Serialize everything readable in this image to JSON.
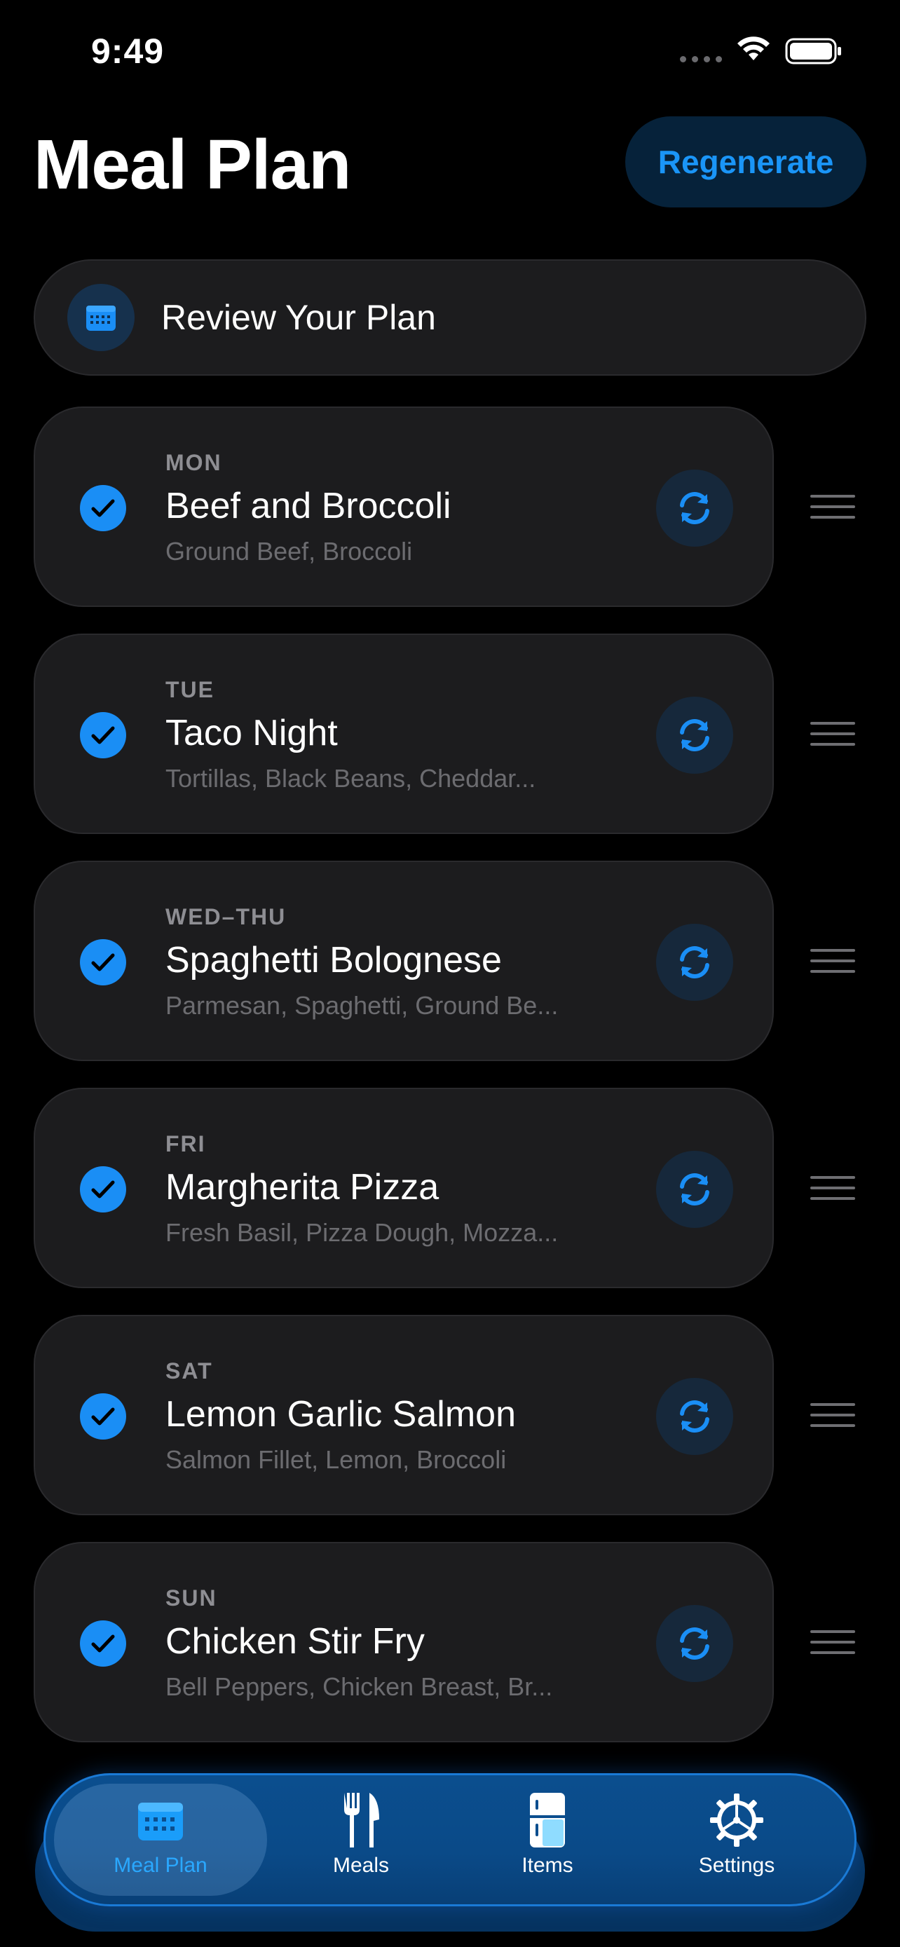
{
  "status_bar": {
    "time": "9:49"
  },
  "header": {
    "title": "Meal Plan",
    "regenerate_label": "Regenerate"
  },
  "review": {
    "label": "Review Your Plan"
  },
  "meals": [
    {
      "day": "MON",
      "name": "Beef and Broccoli",
      "ingredients": "Ground Beef, Broccoli",
      "checked": true
    },
    {
      "day": "TUE",
      "name": "Taco Night",
      "ingredients": "Tortillas, Black Beans, Cheddar...",
      "checked": true
    },
    {
      "day": "WED–THU",
      "name": "Spaghetti Bolognese",
      "ingredients": "Parmesan, Spaghetti, Ground Be...",
      "checked": true
    },
    {
      "day": "FRI",
      "name": "Margherita Pizza",
      "ingredients": "Fresh Basil, Pizza Dough, Mozza...",
      "checked": true
    },
    {
      "day": "SAT",
      "name": "Lemon Garlic Salmon",
      "ingredients": "Salmon Fillet, Lemon, Broccoli",
      "checked": true
    },
    {
      "day": "SUN",
      "name": "Chicken Stir Fry",
      "ingredients": "Bell Peppers, Chicken Breast, Br...",
      "checked": true
    }
  ],
  "tabs": [
    {
      "label": "Meal Plan",
      "icon": "calendar-icon",
      "active": true
    },
    {
      "label": "Meals",
      "icon": "fork-knife-icon",
      "active": false
    },
    {
      "label": "Items",
      "icon": "fridge-icon",
      "active": false
    },
    {
      "label": "Settings",
      "icon": "gear-icon",
      "active": false
    }
  ],
  "colors": {
    "accent": "#1a8ef5",
    "card": "#1c1c1e",
    "background": "#000000",
    "tab_bar": "#0b4e8e"
  }
}
